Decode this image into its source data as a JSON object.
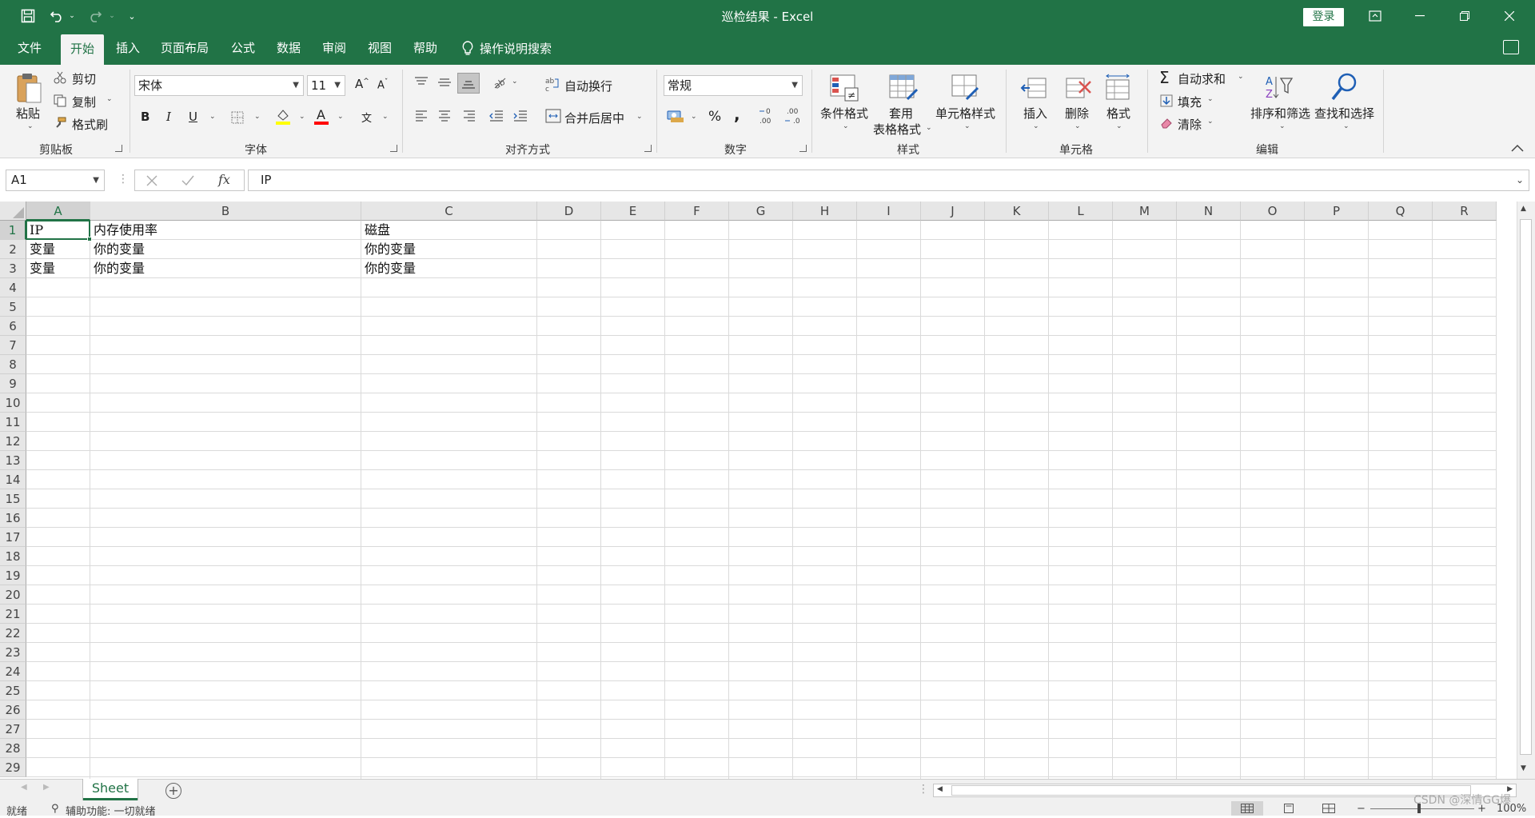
{
  "window": {
    "title": "巡检结果  -  Excel",
    "login": "登录"
  },
  "tabs": [
    {
      "label": "文件"
    },
    {
      "label": "开始"
    },
    {
      "label": "插入"
    },
    {
      "label": "页面布局"
    },
    {
      "label": "公式"
    },
    {
      "label": "数据"
    },
    {
      "label": "审阅"
    },
    {
      "label": "视图"
    },
    {
      "label": "帮助"
    }
  ],
  "tell_me": "操作说明搜索",
  "clipboard": {
    "paste": "粘贴",
    "cut": "剪切",
    "copy": "复制",
    "format_painter": "格式刷",
    "group": "剪贴板"
  },
  "font": {
    "name": "宋体",
    "size": "11",
    "bold": "B",
    "italic": "I",
    "underline": "U",
    "group": "字体",
    "grow": "A",
    "shrink": "A",
    "color_letter": "A",
    "phonetic": "文"
  },
  "alignment": {
    "wrap": "自动换行",
    "merge": "合并后居中",
    "group": "对齐方式"
  },
  "number": {
    "format": "常规",
    "percent": "%",
    "comma": ",",
    "group": "数字"
  },
  "styles": {
    "conditional": "条件格式",
    "table_line1": "套用",
    "table_line2": "表格格式",
    "cell_styles": "单元格样式",
    "group": "样式"
  },
  "cells": {
    "insert": "插入",
    "delete": "删除",
    "format": "格式",
    "group": "单元格"
  },
  "editing": {
    "autosum": "自动求和",
    "fill": "填充",
    "clear": "清除",
    "sort": "排序和筛选",
    "find": "查找和选择",
    "group": "编辑"
  },
  "formula_bar": {
    "name_box": "A1",
    "fx": "fx",
    "content": "IP"
  },
  "columns": [
    "A",
    "B",
    "C",
    "D",
    "E",
    "F",
    "G",
    "H",
    "I",
    "J",
    "K",
    "L",
    "M",
    "N",
    "O",
    "P",
    "Q",
    "R"
  ],
  "rows": [
    "1",
    "2",
    "3",
    "4",
    "5",
    "6",
    "7",
    "8",
    "9",
    "10",
    "11",
    "12",
    "13",
    "14",
    "15",
    "16",
    "17",
    "18",
    "19",
    "20",
    "21",
    "22",
    "23",
    "24",
    "25",
    "26",
    "27",
    "28",
    "29"
  ],
  "cells_data": [
    [
      "IP",
      "内存使用率",
      "磁盘"
    ],
    [
      "变量",
      "你的变量",
      "你的变量"
    ],
    [
      "变量",
      "你的变量",
      "你的变量"
    ]
  ],
  "sheet": {
    "name": "Sheet",
    "add": "+"
  },
  "status": {
    "ready": "就绪",
    "accessibility": "辅助功能: 一切就绪",
    "zoom": "100%"
  },
  "watermark": "CSDN @深情GG爆",
  "colors": {
    "accent": "#217346",
    "ribbon_bg": "#f3f3f3"
  }
}
